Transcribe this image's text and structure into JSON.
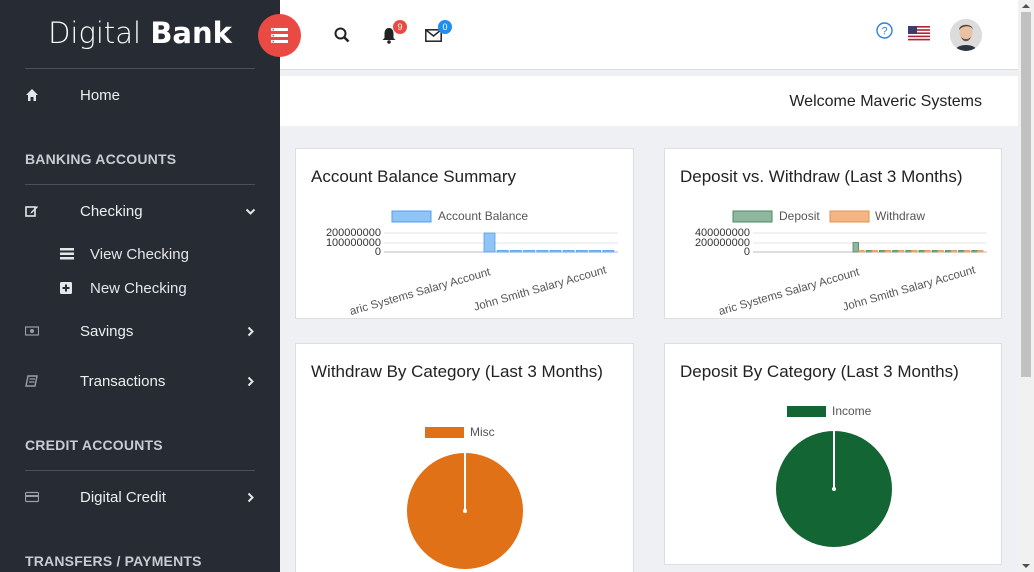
{
  "brand": {
    "light": "Digital",
    "bold": "Bank"
  },
  "sidebar": {
    "home": "Home",
    "banking_header": "BANKING ACCOUNTS",
    "checking": "Checking",
    "view_checking": "View Checking",
    "new_checking": "New Checking",
    "savings": "Savings",
    "transactions": "Transactions",
    "credit_header": "CREDIT ACCOUNTS",
    "digital_credit": "Digital Credit",
    "transfers_header": "TRANSFERS / PAYMENTS"
  },
  "topbar": {
    "notifications_count": "9",
    "messages_count": "0",
    "help": "?"
  },
  "welcome": "Welcome Maveric Systems",
  "colors": {
    "sidebar": "#272b33",
    "accent": "#e94b44",
    "balance": "#90c4f7",
    "deposit": "#8fb79e",
    "withdraw": "#f3b583",
    "misc": "#e07117",
    "income": "#136534"
  },
  "cards": {
    "balance": {
      "title": "Account Balance Summary",
      "legend": "Account Balance",
      "yticks": [
        "200000000",
        "100000000",
        "0"
      ],
      "xlabels": [
        "aric Systems Salary Account",
        "John Smith Salary Account"
      ]
    },
    "depwith": {
      "title": "Deposit vs. Withdraw (Last 3 Months)",
      "legend_dep": "Deposit",
      "legend_with": "Withdraw",
      "yticks": [
        "400000000",
        "200000000",
        "0"
      ],
      "xlabels": [
        "aric Systems Salary Account",
        "John Smith Salary Account"
      ]
    },
    "wcat": {
      "title": "Withdraw By Category (Last 3 Months)",
      "legend": "Misc"
    },
    "dcat": {
      "title": "Deposit By Category (Last 3 Months)",
      "legend": "Income"
    }
  },
  "chart_data": [
    {
      "type": "bar",
      "title": "Account Balance Summary",
      "series": [
        {
          "name": "Account Balance",
          "values": [
            200000000,
            5000000,
            5000000,
            5000000,
            5000000,
            5000000,
            5000000,
            5000000,
            5000000,
            15000000
          ]
        }
      ],
      "ylim": [
        0,
        200000000
      ],
      "yticks": [
        "200000000",
        "100000000",
        "0"
      ],
      "legend": "top"
    },
    {
      "type": "bar",
      "title": "Deposit vs. Withdraw (Last 3 Months)",
      "series": [
        {
          "name": "Deposit",
          "values": [
            200000000,
            5000000,
            5000000,
            5000000,
            5000000,
            5000000,
            5000000,
            5000000,
            5000000,
            15000000
          ]
        },
        {
          "name": "Withdraw",
          "values": [
            10000000,
            5000000,
            5000000,
            5000000,
            5000000,
            5000000,
            5000000,
            5000000,
            5000000,
            10000000
          ]
        }
      ],
      "ylim": [
        0,
        400000000
      ],
      "yticks": [
        "400000000",
        "200000000",
        "0"
      ],
      "legend": "top"
    },
    {
      "type": "pie",
      "title": "Withdraw By Category (Last 3 Months)",
      "categories": [
        "Misc"
      ],
      "values": [
        100
      ]
    },
    {
      "type": "pie",
      "title": "Deposit By Category (Last 3 Months)",
      "categories": [
        "Income"
      ],
      "values": [
        100
      ]
    }
  ]
}
